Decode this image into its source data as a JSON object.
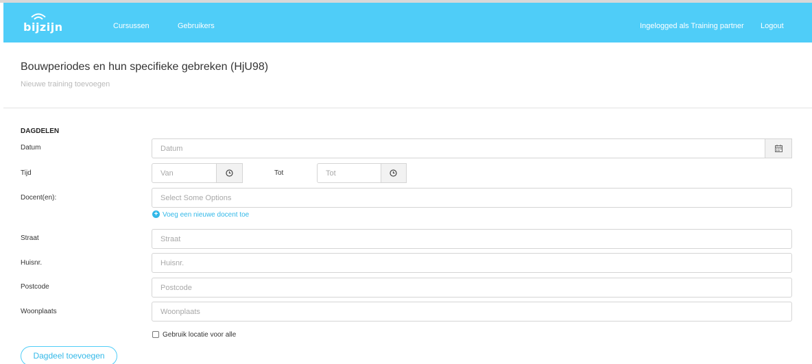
{
  "nav": {
    "logo_text": "bijzijn",
    "links": [
      "Cursussen",
      "Gebruikers"
    ],
    "logged_in_as": "Ingelogged als Training partner",
    "logout": "Logout"
  },
  "header": {
    "title": "Bouwperiodes en hun specifieke gebreken (HjU98)",
    "subtitle": "Nieuwe training toevoegen"
  },
  "form": {
    "section_title": "DAGDELEN",
    "datum": {
      "label": "Datum",
      "placeholder": "Datum",
      "icon": "calendar-icon"
    },
    "tijd": {
      "label": "Tijd",
      "van_placeholder": "Van",
      "tot_label": "Tot",
      "tot_placeholder": "Tot",
      "icon": "clock-icon"
    },
    "docent": {
      "label": "Docent(en):",
      "placeholder": "Select Some Options",
      "add_link": "Voeg een nieuwe docent toe"
    },
    "straat": {
      "label": "Straat",
      "placeholder": "Straat"
    },
    "huisnr": {
      "label": "Huisnr.",
      "placeholder": "Huisnr."
    },
    "postcode": {
      "label": "Postcode",
      "placeholder": "Postcode"
    },
    "woonplaats": {
      "label": "Woonplaats",
      "placeholder": "Woonplaats"
    },
    "checkbox_label": "Gebruik locatie voor alle",
    "add_button": "Dagdeel toevoegen"
  },
  "colors": {
    "nav_bg": "#4fcdf8",
    "accent": "#32b8e8"
  }
}
